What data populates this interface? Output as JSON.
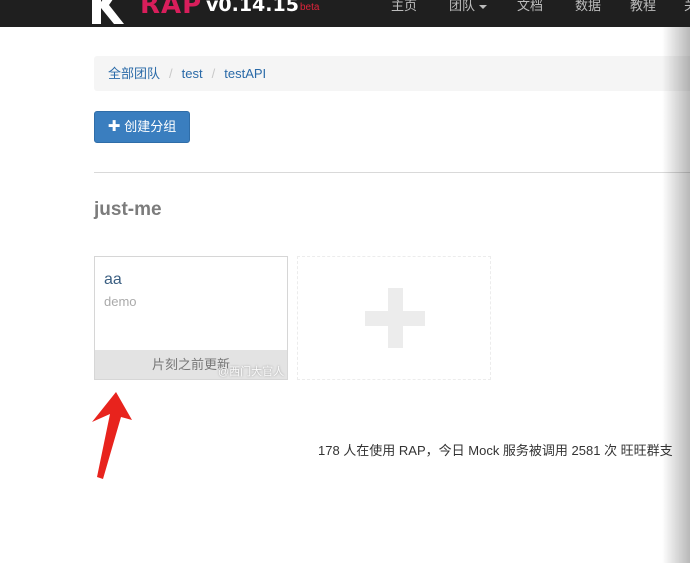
{
  "navbar": {
    "brand": "RAP",
    "version": "v0.14.15",
    "badge": "beta",
    "items": [
      {
        "label": "主页"
      },
      {
        "label": "团队"
      },
      {
        "label": "文档"
      },
      {
        "label": "数据"
      },
      {
        "label": "教程"
      },
      {
        "label": "关"
      }
    ]
  },
  "breadcrumb": [
    "全部团队",
    "test",
    "testAPI"
  ],
  "toolbar": {
    "create_label": "创建分组"
  },
  "group": {
    "title": "just-me",
    "projects": [
      {
        "name": "aa",
        "description": "demo",
        "updated": "片刻之前更新"
      }
    ]
  },
  "watermark": "@西门大官人",
  "footer": {
    "stats": "178 人在使用 RAP，今日 Mock 服务被调用 2581 次    旺旺群支"
  },
  "colors": {
    "navbar_bg": "#1f1f1f",
    "brand": "#d81e5b",
    "primary_button": "#3a7ebf",
    "link": "#2a6aa8",
    "arrow": "#e8231d"
  }
}
